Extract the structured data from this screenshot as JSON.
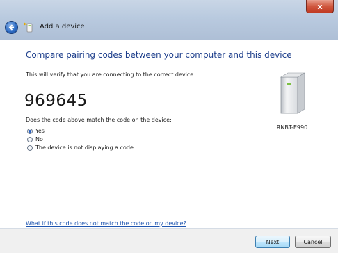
{
  "window": {
    "title": "Add a device",
    "close_label": "x"
  },
  "page": {
    "heading": "Compare pairing codes between your computer and this device",
    "intro": "This will verify that you are connecting to the correct device.",
    "pairing_code": "969645",
    "question": "Does the code above match the code on the device:",
    "options": [
      {
        "label": "Yes",
        "checked": true
      },
      {
        "label": "No",
        "checked": false
      },
      {
        "label": "The device is not displaying a code",
        "checked": false
      }
    ],
    "device_name": "RNBT-E990",
    "help_link": "What if this code does not match the code on my device?"
  },
  "footer": {
    "next_label": "Next",
    "cancel_label": "Cancel"
  },
  "colors": {
    "heading": "#1e3f8c",
    "link": "#1e55b0",
    "close": "#c03a22"
  }
}
